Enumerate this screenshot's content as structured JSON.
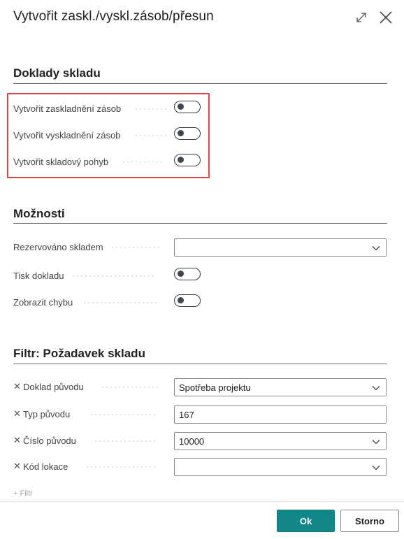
{
  "dialog": {
    "title": "Vytvořit zaskl./vyskl.zásob/přesun"
  },
  "sections": {
    "documents": {
      "title": "Doklady skladu",
      "fields": [
        {
          "label": "Vytvořit zaskladnění zásob",
          "value": "off"
        },
        {
          "label": "Vytvořit vyskladnění zásob",
          "value": "off"
        },
        {
          "label": "Vytvořit skladový pohyb",
          "value": "off"
        }
      ]
    },
    "options": {
      "title": "Možnosti",
      "reserved": {
        "label": "Rezervováno skladem",
        "value": ""
      },
      "print": {
        "label": "Tisk dokladu",
        "value": "off"
      },
      "show_error": {
        "label": "Zobrazit chybu",
        "value": "off"
      }
    },
    "filter": {
      "title": "Filtr: Požadavek skladu",
      "rows": [
        {
          "label": "Doklad původu",
          "value": "Spotřeba projektu",
          "kind": "select"
        },
        {
          "label": "Typ původu",
          "value": "167",
          "kind": "input"
        },
        {
          "label": "Číslo původu",
          "value": "10000",
          "kind": "select"
        },
        {
          "label": "Kód lokace",
          "value": "",
          "kind": "select"
        }
      ],
      "add_filter_partial": "+ Filtr"
    }
  },
  "footer": {
    "ok_label": "Ok",
    "cancel_label": "Storno"
  },
  "colors": {
    "accent": "#11878a",
    "highlight": "#e0464a"
  }
}
